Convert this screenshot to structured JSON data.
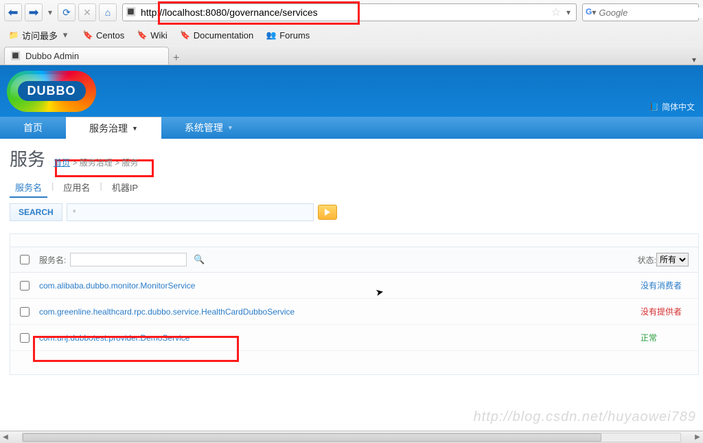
{
  "browser": {
    "url": "http://localhost:8080/governance/services",
    "search_placeholder": "Google",
    "bookmarks": [
      "访问最多",
      "Centos",
      "Wiki",
      "Documentation",
      "Forums"
    ],
    "tab_title": "Dubbo Admin"
  },
  "app": {
    "logo_text": "DUBBO",
    "lang_label": "简体中文",
    "nav": {
      "home": "首页",
      "gov": "服务治理",
      "sys": "系统管理"
    },
    "page_title": "服务",
    "crumb_home": "首页",
    "crumb_gov": "服务治理",
    "crumb_cur": "服务",
    "subtabs": {
      "svc": "服务名",
      "app": "应用名",
      "ip": "机器IP"
    },
    "search_label": "SEARCH",
    "search_default": "*",
    "thead": {
      "svc_label": "服务名:",
      "status_label": "状态:",
      "status_sel": "所有"
    },
    "rows": [
      {
        "svc": "com.alibaba.dubbo.monitor.MonitorService",
        "status": "没有消费者",
        "cls": "s-blue"
      },
      {
        "svc": "com.greenline.healthcard.rpc.dubbo.service.HealthCardDubboService",
        "status": "没有提供者",
        "cls": "s-red"
      },
      {
        "svc": "com.unj.dubbotest.provider.DemoService",
        "status": "正常",
        "cls": "s-green"
      }
    ]
  },
  "watermark": "http://blog.csdn.net/huyaowei789"
}
